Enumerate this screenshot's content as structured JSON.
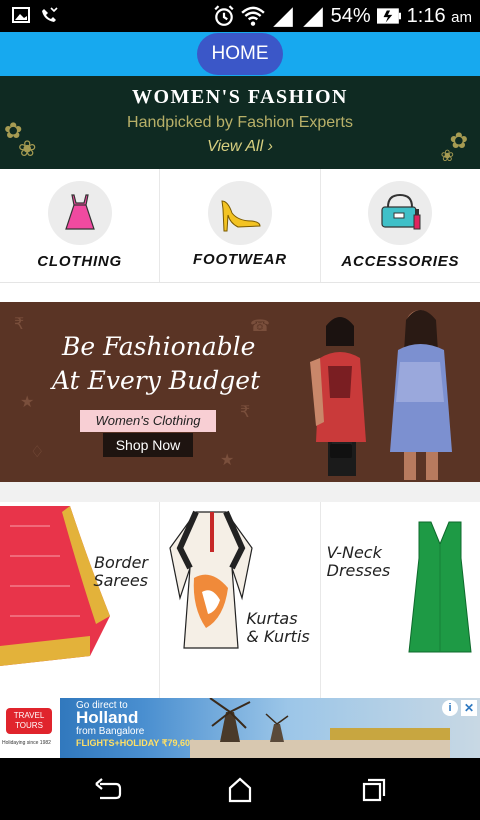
{
  "status_bar": {
    "battery": "54%",
    "time": "1:16",
    "ampm": "am",
    "icons": [
      "image-icon",
      "missed-call-icon",
      "alarm-icon",
      "wifi-icon",
      "signal-icon",
      "signal-icon",
      "battery-icon"
    ]
  },
  "topbar": {
    "home_label": "HOME",
    "color": "#17a9ef",
    "button_color": "#3b57c8"
  },
  "fashion_banner": {
    "title": "WOMEN'S FASHION",
    "subtitle": "Handpicked by Fashion Experts",
    "view_all": "View All ›"
  },
  "categories": [
    {
      "label": "CLOTHING",
      "icon": "dress-icon"
    },
    {
      "label": "FOOTWEAR",
      "icon": "heel-shoe-icon"
    },
    {
      "label": "ACCESSORIES",
      "icon": "handbag-icon"
    }
  ],
  "promo": {
    "line1": "Be Fashionable",
    "line2": "At Every Budget",
    "tag": "Women's Clothing",
    "cta": "Shop Now"
  },
  "products": [
    {
      "label_l1": "Border",
      "label_l2": "Sarees"
    },
    {
      "label_l1": "Kurtas",
      "label_l2": "& Kurtis"
    },
    {
      "label_l1": "V-Neck",
      "label_l2": "Dresses"
    }
  ],
  "ad": {
    "logo_l1": "TRAVEL",
    "logo_l2": "TOURS",
    "since": "Holidaying since 1982",
    "go": "Go direct to",
    "headline": "Holland",
    "from": "from Bangalore",
    "price": "FLIGHTS+HOLIDAY ₹79,600",
    "info": "i",
    "close": "✕"
  },
  "navbar": {
    "icons": [
      "back-icon",
      "home-icon",
      "recents-icon"
    ]
  }
}
